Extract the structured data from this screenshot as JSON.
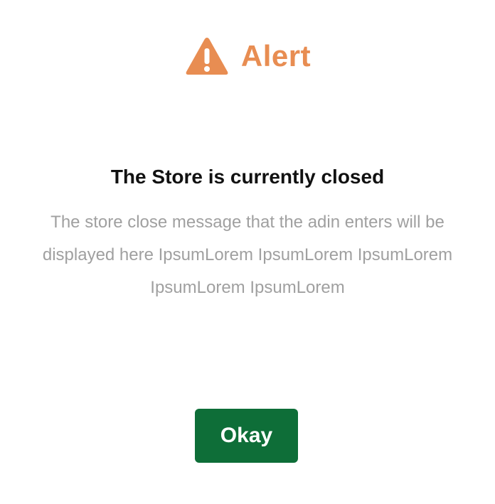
{
  "alert": {
    "icon": "warning-triangle-icon",
    "title": "Alert",
    "accent_color": "#E88D52"
  },
  "content": {
    "heading": "The Store is currently closed",
    "message": "The store close message that the adin enters will be displayed here IpsumLorem IpsumLorem IpsumLorem IpsumLorem IpsumLorem"
  },
  "actions": {
    "okay_label": "Okay",
    "okay_color": "#0E6E38"
  }
}
